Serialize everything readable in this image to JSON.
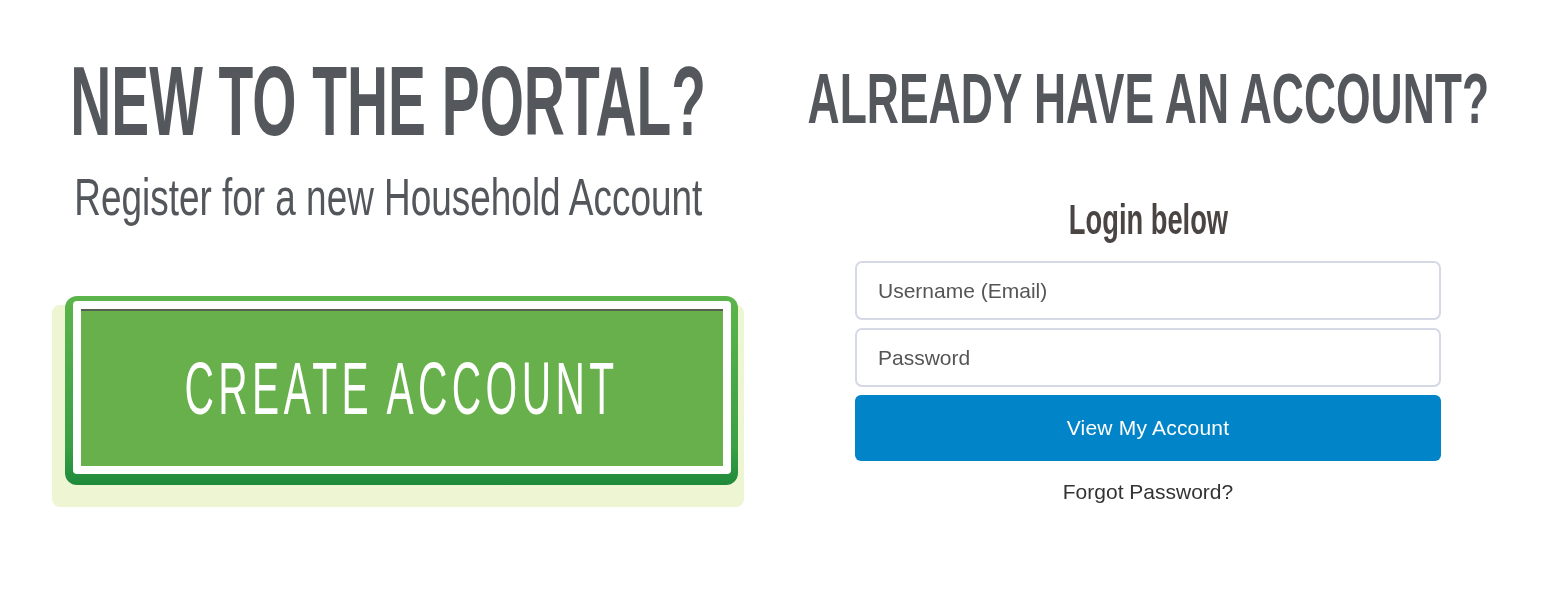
{
  "new_account": {
    "heading": "NEW TO THE PORTAL?",
    "subheading": "Register for a new Household Account",
    "create_button": "CREATE ACCOUNT"
  },
  "login": {
    "heading": "ALREADY HAVE AN ACCOUNT?",
    "subheading": "Login below",
    "fields": [
      {
        "placeholder": "Username (Email)"
      },
      {
        "placeholder": "Password"
      }
    ],
    "submit_button": "View My Account",
    "forgot_link": "Forgot Password?"
  }
}
